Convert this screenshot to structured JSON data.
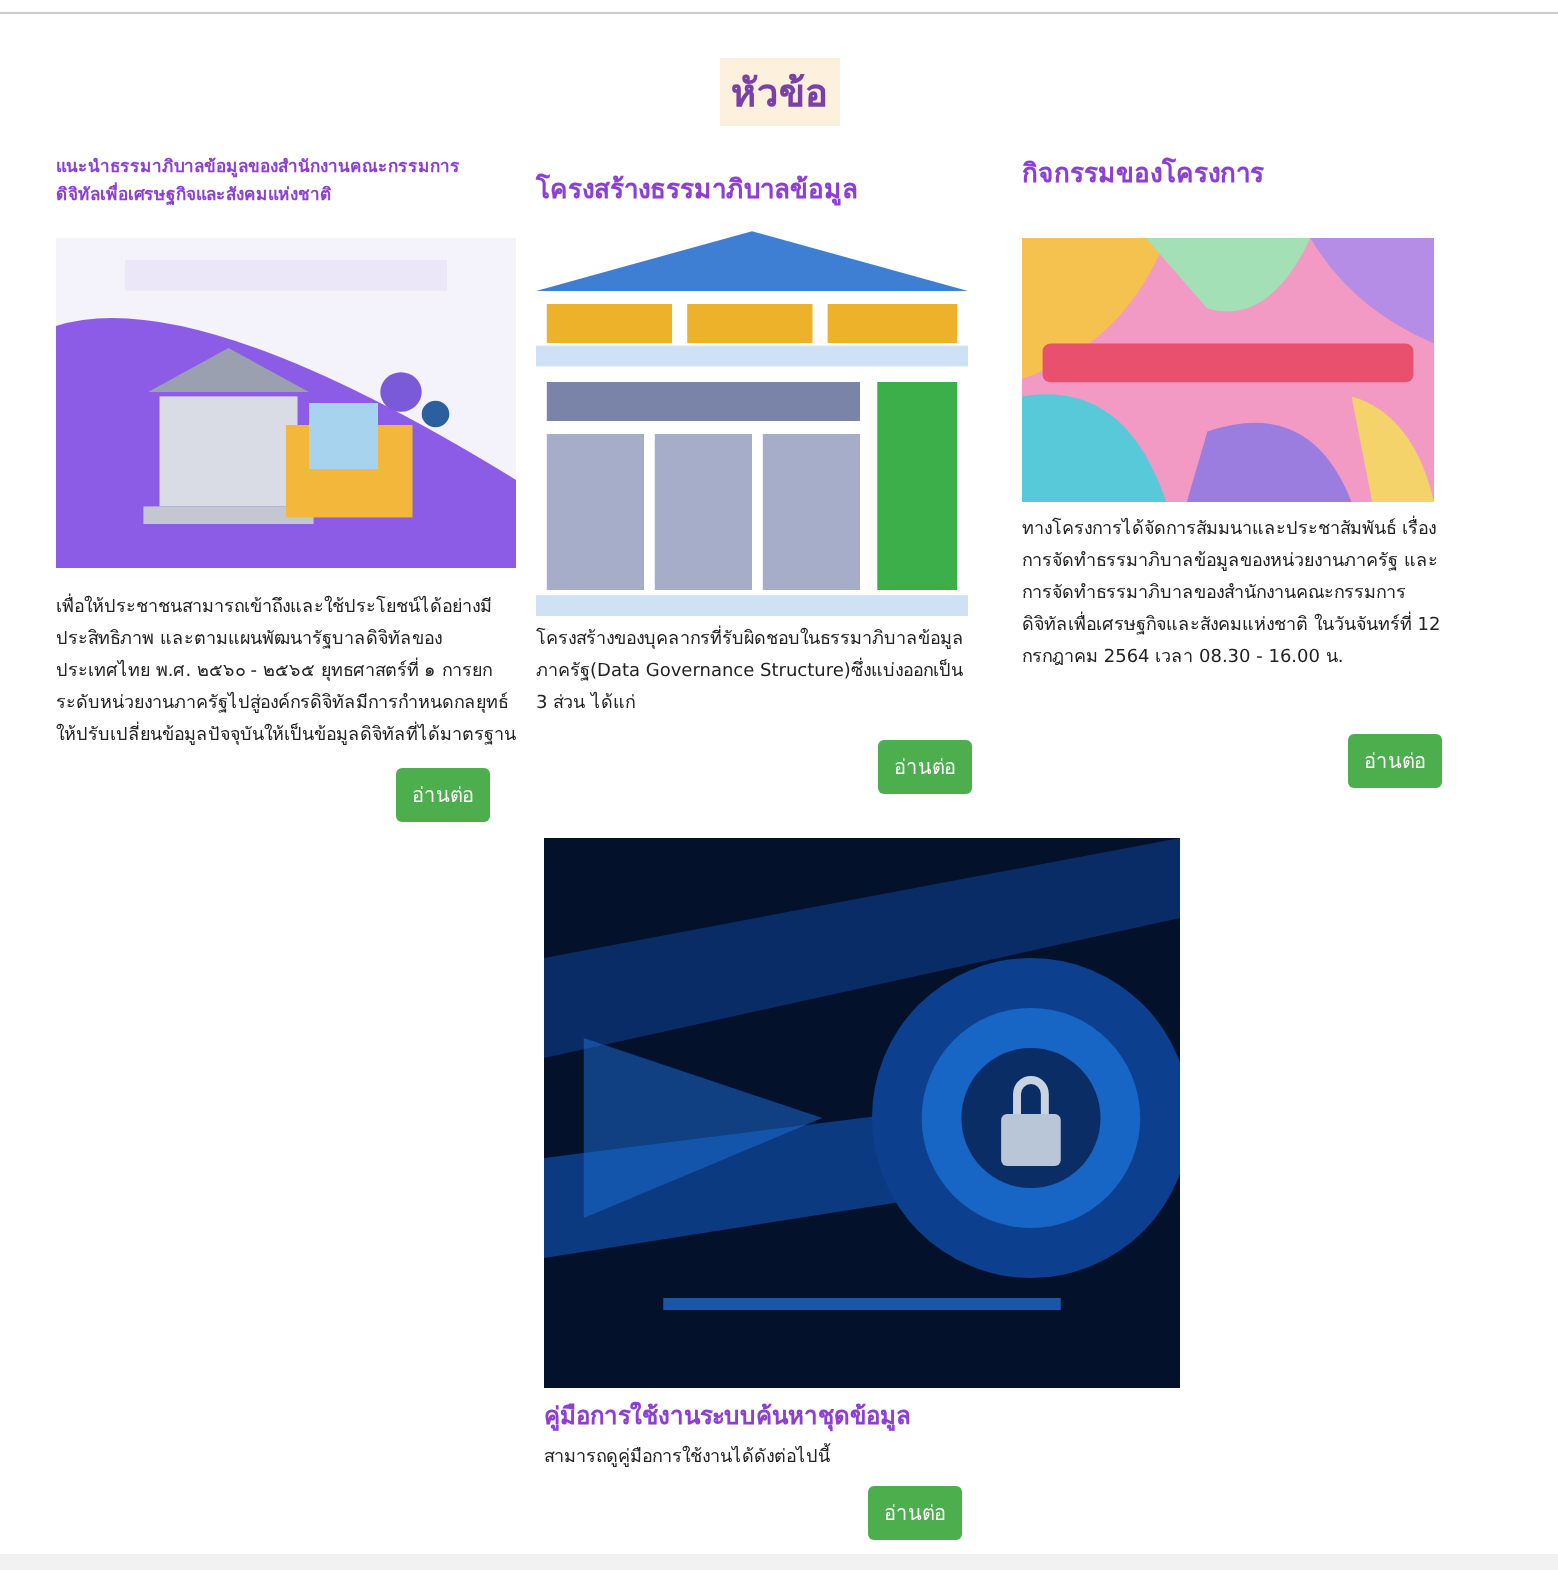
{
  "heading": "หัวข้อ",
  "cards": [
    {
      "title": "แนะนำธรรมาภิบาลข้อมูลของสำนักงานคณะกรรมการดิจิทัลเพื่อเศรษฐกิจและสังคมแห่งชาติ",
      "kind": "compact",
      "text": "เพื่อให้ประชาชนสามารถเข้าถึงและใช้ประโยชน์ได้อย่างมีประสิทธิภาพ และตามแผนพัฒนารัฐบาลดิจิทัลของประเทศไทย พ.ศ. ๒๕๖๐ - ๒๕๖๕ ยุทธศาสตร์ที่ ๑ การยกระดับหน่วยงานภาครัฐไปสู่องค์กรดิจิทัลมีการกำหนดกลยุทธ์ให้ปรับเปลี่ยนข้อมูลปัจจุบันให้เป็นข้อมูลดิจิทัลที่ได้มาตรฐาน",
      "button": "อ่านต่อ"
    },
    {
      "title": "โครงสร้างธรรมาภิบาลข้อมูล",
      "kind": "standard",
      "text": "โครงสร้างของบุคลากรที่รับผิดชอบในธรรมาภิบาลข้อมูลภาครัฐ(Data Governance Structure)ซึ่งแบ่งออกเป็น 3 ส่วน ได้แก่",
      "button": "อ่านต่อ"
    },
    {
      "title": "กิจกรรมของโครงการ",
      "kind": "standard",
      "text": "ทางโครงการได้จัดการสัมมนาและประชาสัมพันธ์ เรื่อง การจัดทำธรรมาภิบาลข้อมูลของหน่วยงานภาครัฐ และการจัดทำธรรมาภิบาลของสำนักงานคณะกรรมการดิจิทัลเพื่อเศรษฐกิจและสังคมแห่งชาติ ในวันจันทร์ที่ 12 กรกฎาคม 2564 เวลา 08.30 - 16.00 น.",
      "button": "อ่านต่อ"
    }
  ],
  "feature": {
    "title": "คู่มือการใช้งานระบบค้นหาชุดข้อมูล",
    "text": "สามารถดูคู่มือการใช้งานได้ดังต่อไปนี้",
    "button": "อ่านต่อ"
  }
}
